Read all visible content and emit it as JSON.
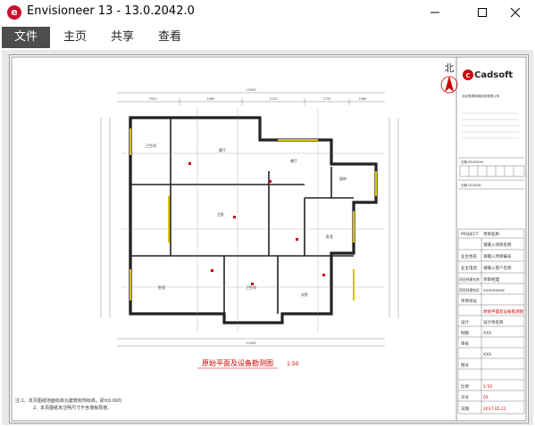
{
  "window": {
    "app_icon_letter": "e",
    "title": "Envisioneer 13 - 13.0.2042.0"
  },
  "menu": {
    "items": [
      {
        "label": "文件",
        "active": true
      },
      {
        "label": "主页",
        "active": false
      },
      {
        "label": "共享",
        "active": false
      },
      {
        "label": "查看",
        "active": false
      }
    ]
  },
  "drawing": {
    "north_label": "北",
    "plan_title": "原始平面及设备勘测图",
    "plan_scale": "1:50",
    "room_labels": [
      "客厅",
      "餐厅",
      "厨房",
      "卧室",
      "主卧",
      "卫生间",
      "次卧",
      "阳台"
    ],
    "notes": [
      "注:1、本页图纸地面标高为建筑粉饰标高，即±0.000;",
      "2、本页图纸未注明尺寸不含墙板厚度。"
    ],
    "title_block": {
      "logo": "Cadsoft",
      "company": "北京惠泰网络科技有限公司",
      "revision_label": "日期 REVISION",
      "legend_label": "日期 LEGEND",
      "rows": [
        {
          "label": "PROJECT",
          "value": "项目名称"
        },
        {
          "label": "",
          "value": "请输入项目名称"
        },
        {
          "label": "业主姓名",
          "value": "请输入项目编号"
        },
        {
          "label": "业主电话",
          "value": "请输入客户名称"
        },
        {
          "label": "项目经理名称",
          "value": "项目经理"
        },
        {
          "label": "项目经理电话",
          "value": "xxxxxxxxx"
        },
        {
          "label": "项目地址",
          "value": ""
        },
        {
          "label": "",
          "value": "原始平面及设备勘测图"
        },
        {
          "label": "设计",
          "value": "设计师名称"
        },
        {
          "label": "制图",
          "value": "XXX"
        },
        {
          "label": "审核",
          "value": "XXX"
        },
        {
          "label": "图号",
          "value": ""
        },
        {
          "label": "比例",
          "value": "1:50"
        },
        {
          "label": "页号",
          "value": "02"
        },
        {
          "label": "日期",
          "value": "2017.05.21"
        }
      ]
    }
  }
}
